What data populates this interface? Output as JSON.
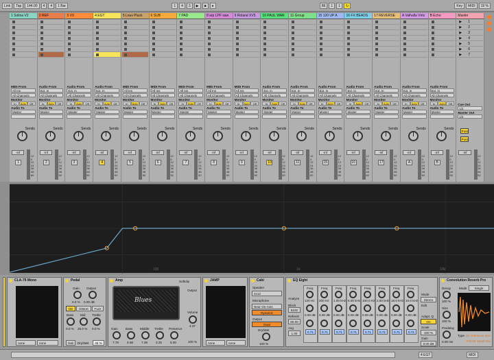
{
  "transport": {
    "link": "Link",
    "tap": "Tap",
    "tempo": "144.00",
    "sig_num": "4",
    "sig_den": "4",
    "quant": "1 Bar",
    "pos1": "1",
    "pos2": "4",
    "pos3": "3",
    "loop_start": "86",
    "loop_pos2": "1",
    "loop_pos3": "1",
    "key": "Key",
    "midi": "MIDI",
    "cpu": "19 %"
  },
  "tracks": [
    {
      "name": "1 Solina V2",
      "color": "#8ad4c4"
    },
    {
      "name": "2 REF",
      "color": "#e87d4a"
    },
    {
      "name": "3 VX",
      "color": "#ff8c3a"
    },
    {
      "name": "4 EGT",
      "color": "#f6e55a"
    },
    {
      "name": "5 Louv Pluck",
      "color": "#c9a26c"
    },
    {
      "name": "6 SUB",
      "color": "#f8a93c"
    },
    {
      "name": "7 PAD",
      "color": "#9ae88c"
    },
    {
      "name": "8 arp LPF saw",
      "color": "#d68bd9"
    },
    {
      "name": "9 Roland XV5",
      "color": "#c79ae0"
    },
    {
      "name": "10 PAUL WAR",
      "color": "#58e07a"
    },
    {
      "name": "11 Group",
      "color": "#7fe08a"
    },
    {
      "name": "15 120 UP A",
      "color": "#9fb8f2"
    },
    {
      "name": "16 FX BEADS",
      "color": "#7ecfe8"
    },
    {
      "name": "17 REVERSE",
      "color": "#e6c07a"
    },
    {
      "name": "A Valhalla Vnts",
      "color": "#d59be8"
    },
    {
      "name": "B Echo",
      "color": "#f59ac2"
    },
    {
      "name": "Master",
      "color": "#f2a3b2"
    }
  ],
  "scenes": [
    "1",
    "2",
    "3",
    "4",
    "5",
    "6",
    "7"
  ],
  "io": {
    "midi_from": "MIDI From",
    "audio_from": "Audio From",
    "all_ins": "All Ins",
    "ext_in": "Ext. In",
    "all_channels": "All Channels",
    "monitor": "Monitor",
    "in": "In",
    "auto": "Auto",
    "off": "Off",
    "audio_to": "Audio To",
    "master": "Master",
    "cue_out": "Cue Out",
    "cue_val": "1/2",
    "master_out": "Master Out",
    "master_val": "1/2"
  },
  "mixer": {
    "sends": "Sends",
    "vol": "-inf",
    "ticks": [
      "12",
      "0",
      "12",
      "24",
      "36",
      "48",
      "60"
    ],
    "track_nums": [
      "1",
      "2",
      "3",
      "4",
      "5",
      "6",
      "7",
      "8",
      "9",
      "10",
      "11",
      "15",
      "16",
      "17",
      "A",
      "B"
    ],
    "post": "Post"
  },
  "eq_freqs": [
    "100",
    "1k",
    "10k"
  ],
  "chart_data": {
    "type": "line",
    "title": "",
    "x": [
      20,
      80,
      100,
      1000,
      10000,
      20000
    ],
    "y": [
      -20,
      -9,
      0,
      0,
      0,
      0
    ],
    "xlabel": "",
    "ylabel": ""
  },
  "devices": {
    "cla76": {
      "title": "CLA-76 Mono",
      "none1": "none",
      "none2": "none"
    },
    "pedal": {
      "title": "Pedal",
      "gain": "Gain",
      "output": "Output",
      "g_val": "0.0 %",
      "o_val": "0.00 dB",
      "od": "OD",
      "distort": "Distort",
      "fuzz": "Fuzz",
      "bass": "Bass",
      "mid": "Mid",
      "treble": "Treble",
      "b_val": "0.0 %",
      "m_val": "25.0 %",
      "t_val": "0.0 %",
      "sub": "Sub",
      "drywet": "Dry/Wet",
      "dw_val": "45 %"
    },
    "amp": {
      "title": "Amp",
      "softclip": "Softclip",
      "brand": "Blues",
      "output": "Output",
      "volume": "Volume",
      "vol_val": "4.37",
      "pct": "100 %",
      "labels": [
        "Gain",
        "Bass",
        "Middle",
        "Treble",
        "Presence"
      ],
      "vals": [
        "7.78",
        "4.68",
        "7.38",
        "3.25",
        "5.00"
      ]
    },
    "jamp": {
      "title": "JAMP",
      "none1": "none",
      "none2": "none"
    },
    "cab": {
      "title": "Cabi",
      "speaker": "Speaker",
      "sp_val": "2x12",
      "mic": "Microphone",
      "mic_val": "Near On-Axis",
      "dynamic": "Dynamic",
      "output": "Output",
      "dual": "Dual",
      "drywet": "Dry/Wet",
      "dw_val": "100 %"
    },
    "eq8": {
      "title": "EQ Eight",
      "analyze": "Analyze",
      "block": "Block",
      "block_val": "8192",
      "refresh": "Refresh",
      "refresh_val": "60.00",
      "avg": "Avg",
      "avg_val": "1.00",
      "bands": [
        {
          "freq": "Freq",
          "f": "120 Hz",
          "gain": "0.00 dB",
          "q": "0.71"
        },
        {
          "freq": "Freq",
          "f": "200 Hz",
          "gain": "0.00 dB",
          "q": "0.71"
        },
        {
          "freq": "Freq",
          "f": "1.00 kHz",
          "gain": "0.00 dB",
          "q": "0.71"
        },
        {
          "freq": "Freq",
          "f": "5.00 kHz",
          "gain": "0.00 dB",
          "q": "0.71"
        },
        {
          "freq": "Freq",
          "f": "100.0 Hz",
          "gain": "0.00 dB",
          "q": "0.71"
        },
        {
          "freq": "Freq",
          "f": "2.50 kHz",
          "gain": "0.00 dB",
          "q": "0.71"
        },
        {
          "freq": "Freq",
          "f": "18.0 kHz",
          "gain": "0.00 dB",
          "q": "0.71"
        },
        {
          "freq": "Freq",
          "f": "10.0 kHz",
          "gain": "0.00 dB",
          "q": "0.71"
        }
      ],
      "mode": "Mode",
      "mode_val": "Stereo",
      "edit": "Edit",
      "adapt": "Adapt. Q",
      "adapt_val": "On",
      "scale": "Scale",
      "scale_val": "100 %",
      "gain": "Gain",
      "gain_val": "0.00 dB"
    },
    "conv": {
      "title": "Convolution Reverb Pro",
      "mode": "Mode",
      "mode_val": "Single",
      "decay": "Decay",
      "decay_val": "100 %",
      "size": "Size",
      "size_val": "100 %",
      "predelay": "Predelay",
      "pd_val": "0.00 ms",
      "type": "Type",
      "type_val": "02 Ambience and",
      "ir": "TVC33 Small Gui"
    }
  },
  "status": {
    "track": "4 EGT",
    "midi": "MIDI"
  }
}
